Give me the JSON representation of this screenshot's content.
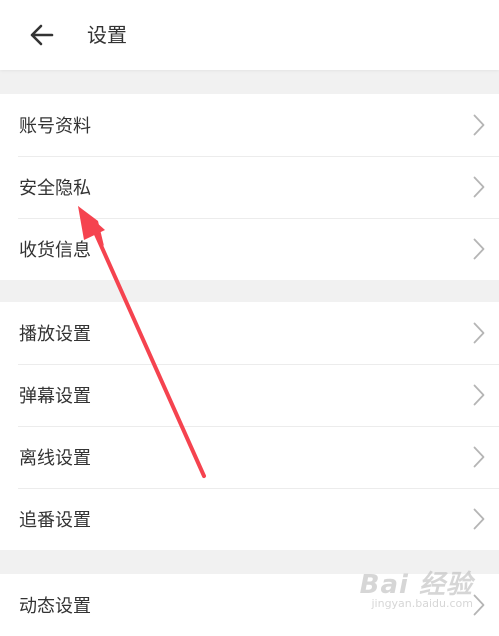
{
  "header": {
    "title": "设置"
  },
  "groups": [
    {
      "items": [
        {
          "label": "账号资料"
        },
        {
          "label": "安全隐私"
        },
        {
          "label": "收货信息"
        }
      ]
    },
    {
      "items": [
        {
          "label": "播放设置"
        },
        {
          "label": "弹幕设置"
        },
        {
          "label": "离线设置"
        },
        {
          "label": "追番设置"
        }
      ]
    },
    {
      "items": [
        {
          "label": "动态设置"
        }
      ]
    }
  ],
  "watermark": {
    "logo": "Bai 经验",
    "url": "jingyan.baidu.com"
  },
  "annotation": {
    "color": "#f5434f",
    "icon": "red-arrow-annotation"
  }
}
